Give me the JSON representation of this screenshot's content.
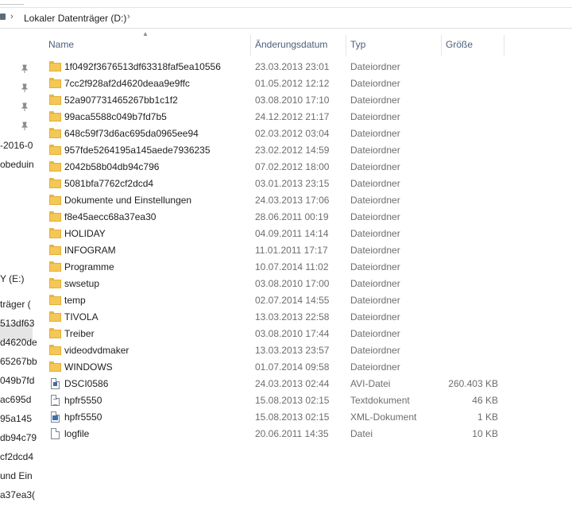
{
  "address": {
    "drive_icon": "drive-icon",
    "path": "Lokaler Datenträger (D:)"
  },
  "sidebar": {
    "fragments": [
      "-2016-0",
      "obeduin",
      "Y (E:)",
      "träger (",
      "513df63",
      "d4620de",
      "65267bb",
      "049b7fd",
      "ac695d",
      "95a145",
      "db94c79",
      "cf2dcd4",
      "und Ein",
      "a37ea3("
    ]
  },
  "columns": {
    "name": "Name",
    "date": "Änderungsdatum",
    "type": "Typ",
    "size": "Größe"
  },
  "files": [
    {
      "name": "1f0492f3676513df63318faf5ea10556",
      "date": "23.03.2013 23:01",
      "type": "Dateiordner",
      "size": "",
      "icon": "folder"
    },
    {
      "name": "7cc2f928af2d4620deaa9e9ffc",
      "date": "01.05.2012 12:12",
      "type": "Dateiordner",
      "size": "",
      "icon": "folder"
    },
    {
      "name": "52a907731465267bb1c1f2",
      "date": "03.08.2010 17:10",
      "type": "Dateiordner",
      "size": "",
      "icon": "folder"
    },
    {
      "name": "99aca5588c049b7fd7b5",
      "date": "24.12.2012 21:17",
      "type": "Dateiordner",
      "size": "",
      "icon": "folder"
    },
    {
      "name": "648c59f73d6ac695da0965ee94",
      "date": "02.03.2012 03:04",
      "type": "Dateiordner",
      "size": "",
      "icon": "folder"
    },
    {
      "name": "957fde5264195a145aede7936235",
      "date": "23.02.2012 14:59",
      "type": "Dateiordner",
      "size": "",
      "icon": "folder"
    },
    {
      "name": "2042b58b04db94c796",
      "date": "07.02.2012 18:00",
      "type": "Dateiordner",
      "size": "",
      "icon": "folder"
    },
    {
      "name": "5081bfa7762cf2dcd4",
      "date": "03.01.2013 23:15",
      "type": "Dateiordner",
      "size": "",
      "icon": "folder"
    },
    {
      "name": "Dokumente und Einstellungen",
      "date": "24.03.2013 17:06",
      "type": "Dateiordner",
      "size": "",
      "icon": "folder"
    },
    {
      "name": "f8e45aecc68a37ea30",
      "date": "28.06.2011 00:19",
      "type": "Dateiordner",
      "size": "",
      "icon": "folder"
    },
    {
      "name": "HOLIDAY",
      "date": "04.09.2011 14:14",
      "type": "Dateiordner",
      "size": "",
      "icon": "folder"
    },
    {
      "name": "INFOGRAM",
      "date": "11.01.2011 17:17",
      "type": "Dateiordner",
      "size": "",
      "icon": "folder"
    },
    {
      "name": "Programme",
      "date": "10.07.2014 11:02",
      "type": "Dateiordner",
      "size": "",
      "icon": "folder"
    },
    {
      "name": "swsetup",
      "date": "03.08.2010 17:00",
      "type": "Dateiordner",
      "size": "",
      "icon": "folder"
    },
    {
      "name": "temp",
      "date": "02.07.2014 14:55",
      "type": "Dateiordner",
      "size": "",
      "icon": "folder"
    },
    {
      "name": "TIVOLA",
      "date": "13.03.2013 22:58",
      "type": "Dateiordner",
      "size": "",
      "icon": "folder"
    },
    {
      "name": "Treiber",
      "date": "03.08.2010 17:44",
      "type": "Dateiordner",
      "size": "",
      "icon": "folder"
    },
    {
      "name": "videodvdmaker",
      "date": "13.03.2013 23:57",
      "type": "Dateiordner",
      "size": "",
      "icon": "folder"
    },
    {
      "name": "WINDOWS",
      "date": "01.07.2014 09:58",
      "type": "Dateiordner",
      "size": "",
      "icon": "folder"
    },
    {
      "name": "DSCI0586",
      "date": "24.03.2013 02:44",
      "type": "AVI-Datei",
      "size": "260.403 KB",
      "icon": "video-file"
    },
    {
      "name": "hpfr5550",
      "date": "15.08.2013 02:15",
      "type": "Textdokument",
      "size": "46 KB",
      "icon": "text-file"
    },
    {
      "name": "hpfr5550",
      "date": "15.08.2013 02:15",
      "type": "XML-Dokument",
      "size": "1 KB",
      "icon": "xml-file"
    },
    {
      "name": "logfile",
      "date": "20.06.2011 14:35",
      "type": "Datei",
      "size": "10 KB",
      "icon": "generic-file"
    }
  ]
}
